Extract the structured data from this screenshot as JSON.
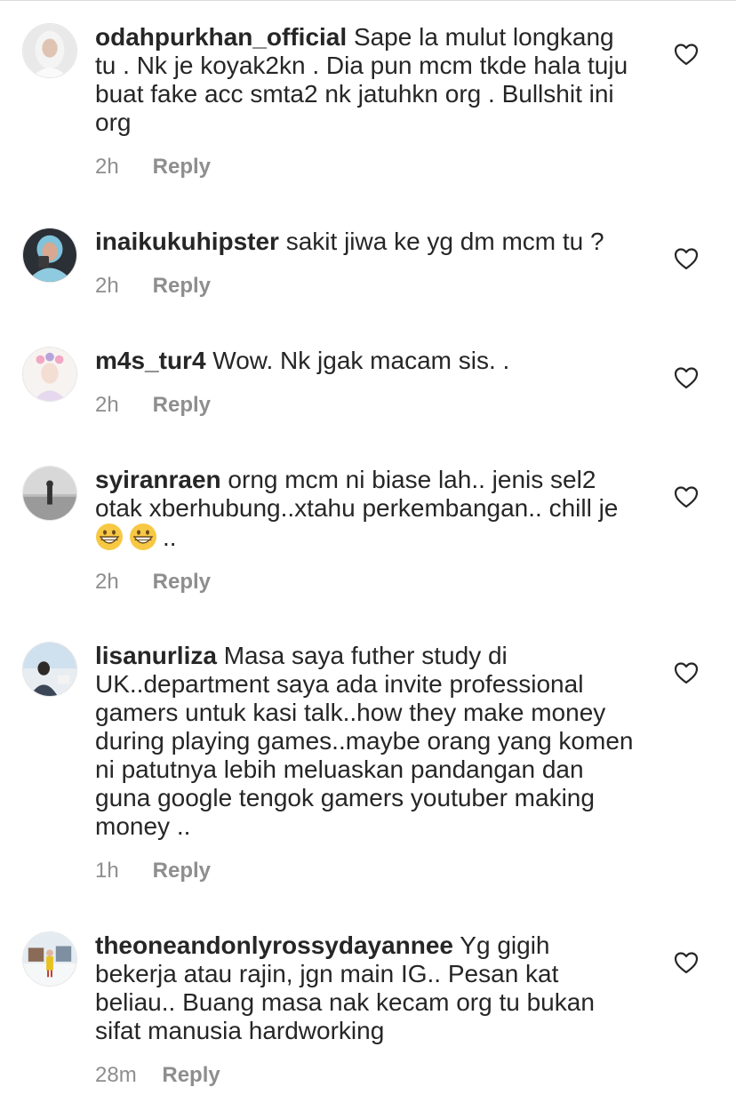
{
  "comments": [
    {
      "username": "odahpurkhan_official",
      "text": "Sape la mulut longkang tu . Nk je koyak2kn . Dia pun mcm tkde hala tuju buat fake acc smta2 nk jatuhkn org . Bullshit ini org",
      "time": "2h",
      "reply_label": "Reply",
      "icon": "heart-outline-icon"
    },
    {
      "username": "inaikukuhipster",
      "text": "sakit jiwa ke yg dm mcm tu ?",
      "time": "2h",
      "reply_label": "Reply",
      "icon": "heart-outline-icon"
    },
    {
      "username": "m4s_tur4",
      "text": "Wow. Nk jgak macam sis. .",
      "time": "2h",
      "reply_label": "Reply",
      "icon": "heart-outline-icon"
    },
    {
      "username": "syiranraen",
      "text": "orng mcm ni biase lah.. jenis sel2 otak xberhubung..xtahu perkembangan.. chill je",
      "text_suffix": "..",
      "emojis": [
        "grinning-face-emoji",
        "grinning-face-emoji"
      ],
      "time": "2h",
      "reply_label": "Reply",
      "icon": "heart-outline-icon"
    },
    {
      "username": "lisanurliza",
      "text": "Masa saya futher study di UK..department saya ada invite professional gamers untuk kasi talk..how they make money during playing games..maybe orang yang komen ni patutnya lebih meluaskan pandangan dan guna google tengok gamers youtuber making money ..",
      "time": "1h",
      "reply_label": "Reply",
      "icon": "heart-outline-icon"
    },
    {
      "username": "theoneandonlyrossydayannee",
      "text": "Yg gigih bekerja atau rajin, jgn main IG.. Pesan kat beliau.. Buang masa nak kecam org tu bukan sifat manusia hardworking",
      "time": "28m",
      "reply_label": "Reply",
      "icon": "heart-outline-icon"
    }
  ],
  "colors": {
    "text": "#262626",
    "muted": "#8e8e8e",
    "divider": "#dbdbdb"
  }
}
